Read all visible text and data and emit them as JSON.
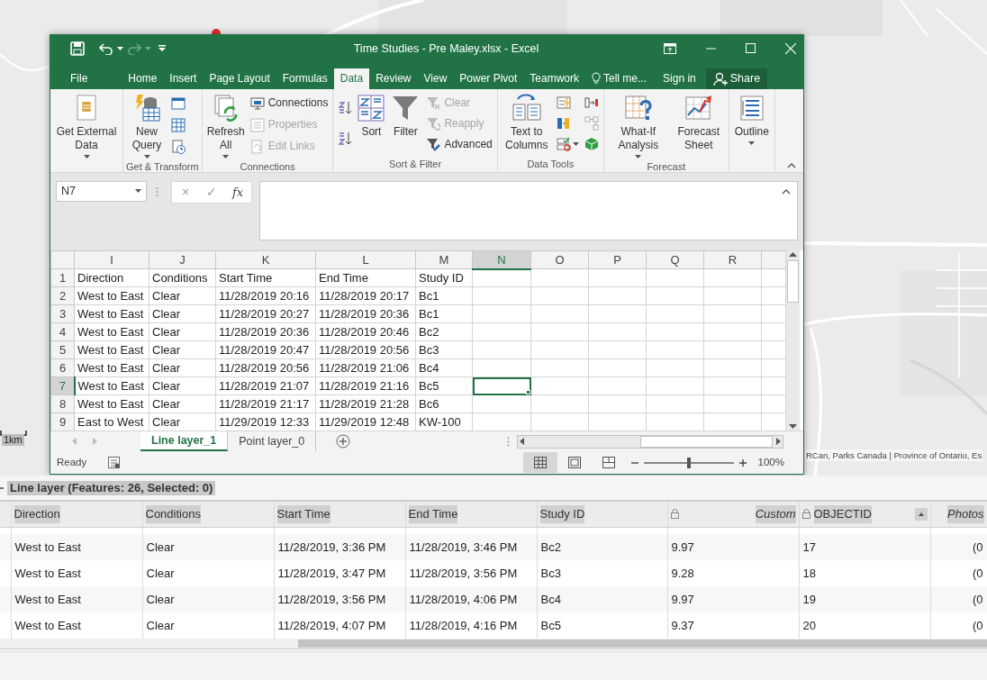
{
  "map": {
    "scale_label": "1km",
    "attribution": "RCan, Parks Canada | Province of Ontario, Es"
  },
  "excel": {
    "title": "Time Studies - Pre Maley.xlsx - Excel",
    "tabs": [
      {
        "label": "File",
        "selected": false
      },
      {
        "label": "Home",
        "selected": false
      },
      {
        "label": "Insert",
        "selected": false
      },
      {
        "label": "Page Layout",
        "selected": false
      },
      {
        "label": "Formulas",
        "selected": false
      },
      {
        "label": "Data",
        "selected": true
      },
      {
        "label": "Review",
        "selected": false
      },
      {
        "label": "View",
        "selected": false
      },
      {
        "label": "Power Pivot",
        "selected": false
      },
      {
        "label": "Teamwork",
        "selected": false
      }
    ],
    "tell_me": "Tell me...",
    "sign_in": "Sign in",
    "share": "Share",
    "ribbon": [
      {
        "commands": [
          {
            "kind": "large",
            "label": "Get External Data",
            "dropdown": true,
            "disabled": false
          }
        ]
      },
      {
        "label": "Get & Transform",
        "commands": [
          {
            "kind": "large",
            "label": "New Query",
            "dropdown": true,
            "disabled": false
          },
          {
            "kind": "icon"
          },
          {
            "kind": "icon"
          },
          {
            "kind": "icon"
          }
        ]
      },
      {
        "label": "Connections",
        "commands": [
          {
            "kind": "large",
            "label": "Refresh All",
            "dropdown": true,
            "disabled": false
          },
          {
            "kind": "small",
            "label": "Connections",
            "disabled": false
          },
          {
            "kind": "small",
            "label": "Properties",
            "disabled": true
          },
          {
            "kind": "small",
            "label": "Edit Links",
            "disabled": true
          }
        ]
      },
      {
        "label": "Sort & Filter",
        "commands": [
          {
            "kind": "icon"
          },
          {
            "kind": "icon"
          },
          {
            "kind": "large",
            "label": "Sort",
            "dropdown": false,
            "disabled": false
          },
          {
            "kind": "large",
            "label": "Filter",
            "dropdown": false,
            "disabled": false
          },
          {
            "kind": "small",
            "label": "Clear",
            "disabled": true
          },
          {
            "kind": "small",
            "label": "Reapply",
            "disabled": true
          },
          {
            "kind": "small",
            "label": "Advanced",
            "disabled": false
          }
        ]
      },
      {
        "label": "Data Tools",
        "commands": [
          {
            "kind": "large",
            "label": "Text to Columns",
            "dropdown": false,
            "disabled": false
          },
          {
            "kind": "icon"
          },
          {
            "kind": "icon"
          },
          {
            "kind": "icon"
          },
          {
            "kind": "icon"
          },
          {
            "kind": "icon"
          },
          {
            "kind": "icon"
          }
        ]
      },
      {
        "label": "Forecast",
        "commands": [
          {
            "kind": "large",
            "label": "What-If Analysis",
            "dropdown": true,
            "disabled": false
          },
          {
            "kind": "large",
            "label": "Forecast Sheet",
            "dropdown": false,
            "disabled": false
          }
        ]
      },
      {
        "commands": [
          {
            "kind": "large",
            "label": "Outline",
            "dropdown": true,
            "disabled": false
          }
        ]
      }
    ],
    "name_box": "N7",
    "formula_buttons": [
      "×",
      "✓",
      "fx"
    ],
    "sheet": {
      "columns": [
        {
          "label": "I",
          "selected": false
        },
        {
          "label": "J",
          "selected": false
        },
        {
          "label": "K",
          "selected": false
        },
        {
          "label": "L",
          "selected": false
        },
        {
          "label": "M",
          "selected": false
        },
        {
          "label": "N",
          "selected": true
        },
        {
          "label": "O",
          "selected": false
        },
        {
          "label": "P",
          "selected": false
        },
        {
          "label": "Q",
          "selected": false
        },
        {
          "label": "R",
          "selected": false
        }
      ],
      "rows": [
        {
          "label": "1",
          "selected": false,
          "cells": [
            "Direction",
            "Conditions",
            "Start Time",
            "End Time",
            "Study ID"
          ]
        },
        {
          "label": "2",
          "selected": false,
          "cells": [
            "West to East",
            "Clear",
            "11/28/2019 20:16",
            "11/28/2019 20:17",
            "Bc1"
          ]
        },
        {
          "label": "3",
          "selected": false,
          "cells": [
            "West to East",
            "Clear",
            "11/28/2019 20:27",
            "11/28/2019 20:36",
            "Bc1"
          ]
        },
        {
          "label": "4",
          "selected": false,
          "cells": [
            "West to East",
            "Clear",
            "11/28/2019 20:36",
            "11/28/2019 20:46",
            "Bc2"
          ]
        },
        {
          "label": "5",
          "selected": false,
          "cells": [
            "West to East",
            "Clear",
            "11/28/2019 20:47",
            "11/28/2019 20:56",
            "Bc3"
          ]
        },
        {
          "label": "6",
          "selected": false,
          "cells": [
            "West to East",
            "Clear",
            "11/28/2019 20:56",
            "11/28/2019 21:06",
            "Bc4"
          ]
        },
        {
          "label": "7",
          "selected": true,
          "cells": [
            "West to East",
            "Clear",
            "11/28/2019 21:07",
            "11/28/2019 21:16",
            "Bc5"
          ]
        },
        {
          "label": "8",
          "selected": false,
          "cells": [
            "West to East",
            "Clear",
            "11/28/2019 21:17",
            "11/28/2019 21:28",
            "Bc6"
          ]
        },
        {
          "label": "9",
          "selected": false,
          "cells": [
            "East to West",
            "Clear",
            "11/29/2019 12:33",
            "11/29/2019 12:48",
            "KW-100"
          ]
        }
      ]
    },
    "sheet_tabs": [
      {
        "label": "Line layer_1",
        "selected": true
      },
      {
        "label": "Point layer_0",
        "selected": false
      }
    ],
    "status": {
      "text": "Ready",
      "views": [
        {
          "selected": true
        },
        {
          "selected": false
        },
        {
          "selected": false
        }
      ],
      "zoom": {
        "level": 0.5,
        "label": "100%"
      }
    }
  },
  "attribute_table": {
    "title": "Line layer (Features: 26, Selected: 0)",
    "columns": [
      {
        "label": "Direction",
        "kind": "field",
        "locked": false,
        "sorted": false
      },
      {
        "label": "Conditions",
        "kind": "field",
        "locked": false,
        "sorted": false
      },
      {
        "label": "Start Time",
        "kind": "field",
        "locked": false,
        "sorted": false
      },
      {
        "label": "End Time",
        "kind": "field",
        "locked": false,
        "sorted": false
      },
      {
        "label": "Study ID",
        "kind": "field",
        "locked": false,
        "sorted": false
      },
      {
        "label": "Custom",
        "kind": "custom",
        "locked": true,
        "sorted": false
      },
      {
        "label": "OBJECTID",
        "kind": "field",
        "locked": true,
        "sorted": true
      },
      {
        "label": "Photos",
        "kind": "custom",
        "locked": false,
        "sorted": false
      }
    ],
    "rows": [
      [
        "West to East",
        "Clear",
        "11/28/2019, 3:36 PM",
        "11/28/2019, 3:46 PM",
        "Bc2",
        "9.97",
        "17",
        "(0"
      ],
      [
        "West to East",
        "Clear",
        "11/28/2019, 3:47 PM",
        "11/28/2019, 3:56 PM",
        "Bc3",
        "9.28",
        "18",
        "(0"
      ],
      [
        "West to East",
        "Clear",
        "11/28/2019, 3:56 PM",
        "11/28/2019, 4:06 PM",
        "Bc4",
        "9.97",
        "19",
        "(0"
      ],
      [
        "West to East",
        "Clear",
        "11/28/2019, 4:07 PM",
        "11/28/2019, 4:16 PM",
        "Bc5",
        "9.37",
        "20",
        "(0"
      ]
    ]
  }
}
